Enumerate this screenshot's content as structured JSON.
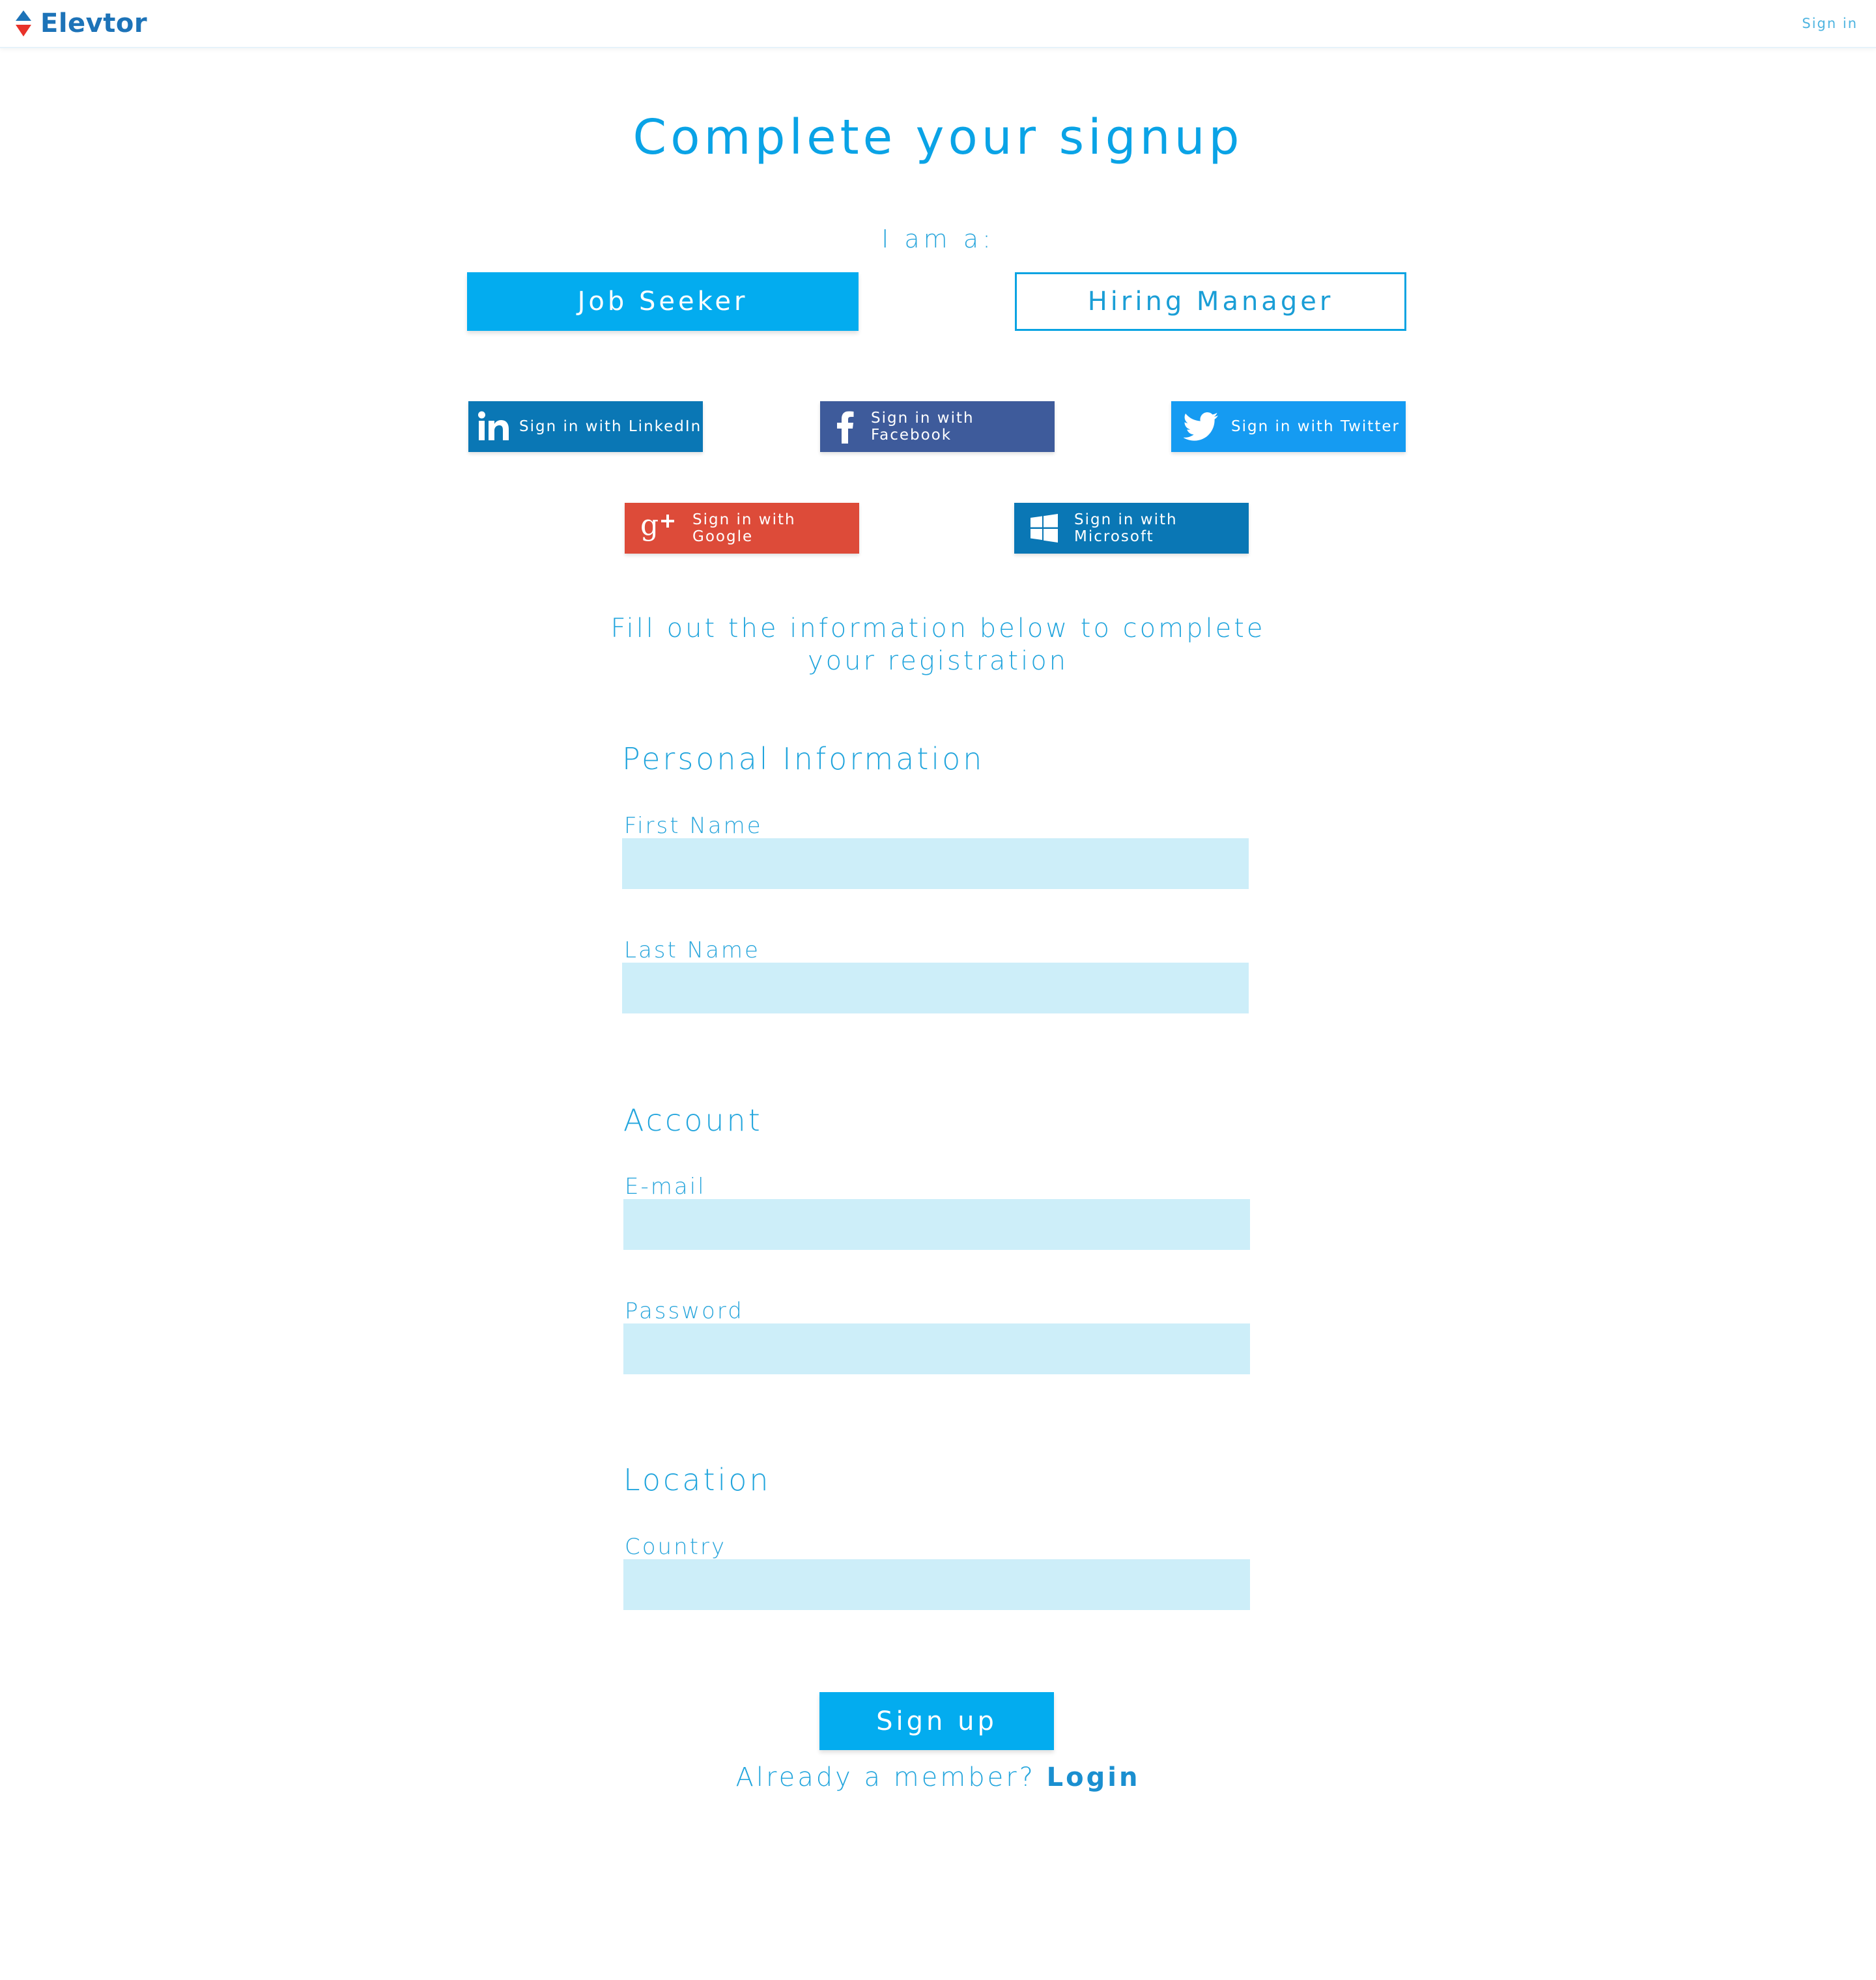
{
  "header": {
    "brand": "Elevtor",
    "sign_in": "Sign in"
  },
  "title": "Complete your signup",
  "role": {
    "label": "I am a:",
    "options": [
      "Job Seeker",
      "Hiring Manager"
    ],
    "selected": "Job Seeker"
  },
  "social": {
    "linkedin": "Sign in with LinkedIn",
    "facebook": "Sign in with Facebook",
    "twitter": "Sign in with Twitter",
    "google": "Sign in with Google",
    "microsoft": "Sign in with Microsoft"
  },
  "instructions_line1": "Fill out the information below to complete",
  "instructions_line2": "your registration",
  "personal": {
    "title": "Personal Information",
    "first_name_label": "First Name",
    "first_name_value": "",
    "last_name_label": "Last Name",
    "last_name_value": ""
  },
  "account": {
    "title": "Account",
    "email_label": "E-mail",
    "email_value": "",
    "password_label": "Password",
    "password_value": ""
  },
  "location": {
    "title": "Location",
    "country_label": "Country",
    "country_value": ""
  },
  "signup_button": "Sign up",
  "footer": {
    "already_member": "Already a member?",
    "login": "Login"
  },
  "colors": {
    "primary": "#03acef",
    "text": "#22a5dd",
    "field_bg": "#cdeef9",
    "linkedin": "#0a77b5",
    "facebook": "#3e5b9b",
    "twitter": "#159bf2",
    "google": "#dd4b39",
    "microsoft": "#0a77b5"
  }
}
